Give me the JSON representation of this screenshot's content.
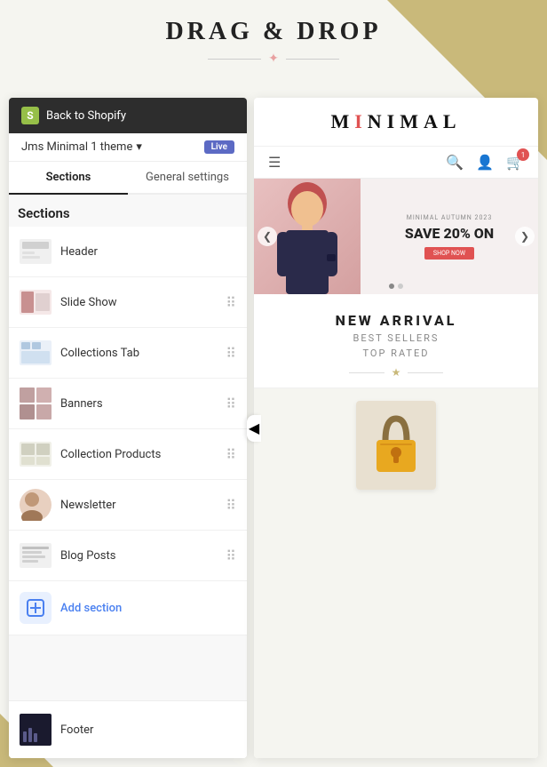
{
  "page": {
    "title": "DRAG & DROP",
    "divider_star": "✦"
  },
  "back_bar": {
    "label": "Back to Shopify"
  },
  "theme_bar": {
    "theme_name": "Jms Minimal 1 theme",
    "chevron": "▾",
    "live_badge": "Live"
  },
  "tabs": {
    "sections_label": "Sections",
    "general_label": "General settings"
  },
  "sections_header": "Sections",
  "sections": [
    {
      "id": "header",
      "label": "Header",
      "has_drag": false
    },
    {
      "id": "slideshow",
      "label": "Slide Show",
      "has_drag": true
    },
    {
      "id": "collections-tab",
      "label": "Collections Tab",
      "has_drag": true
    },
    {
      "id": "banners",
      "label": "Banners",
      "has_drag": true
    },
    {
      "id": "collection-products",
      "label": "Collection Products",
      "has_drag": true
    },
    {
      "id": "newsletter",
      "label": "Newsletter",
      "has_drag": true
    },
    {
      "id": "blog-posts",
      "label": "Blog Posts",
      "has_drag": true
    }
  ],
  "add_section": {
    "label": "Add section"
  },
  "footer": {
    "label": "Footer"
  },
  "store": {
    "logo": "MINIMAL",
    "hero": {
      "subtitle": "MINIMAL AUTUMN 2023",
      "discount": "SAVE 20% ON",
      "btn_label": "SHOP NOW"
    },
    "middle": {
      "line1": "NEW ARRIVAL",
      "line2": "BEST SELLERS",
      "line3": "TOP RATED"
    }
  },
  "collapse_arrow": "◀",
  "drag_handle_char": "⠿",
  "dots": [
    "active",
    "inactive"
  ],
  "slider_left": "❮",
  "slider_right": "❯"
}
